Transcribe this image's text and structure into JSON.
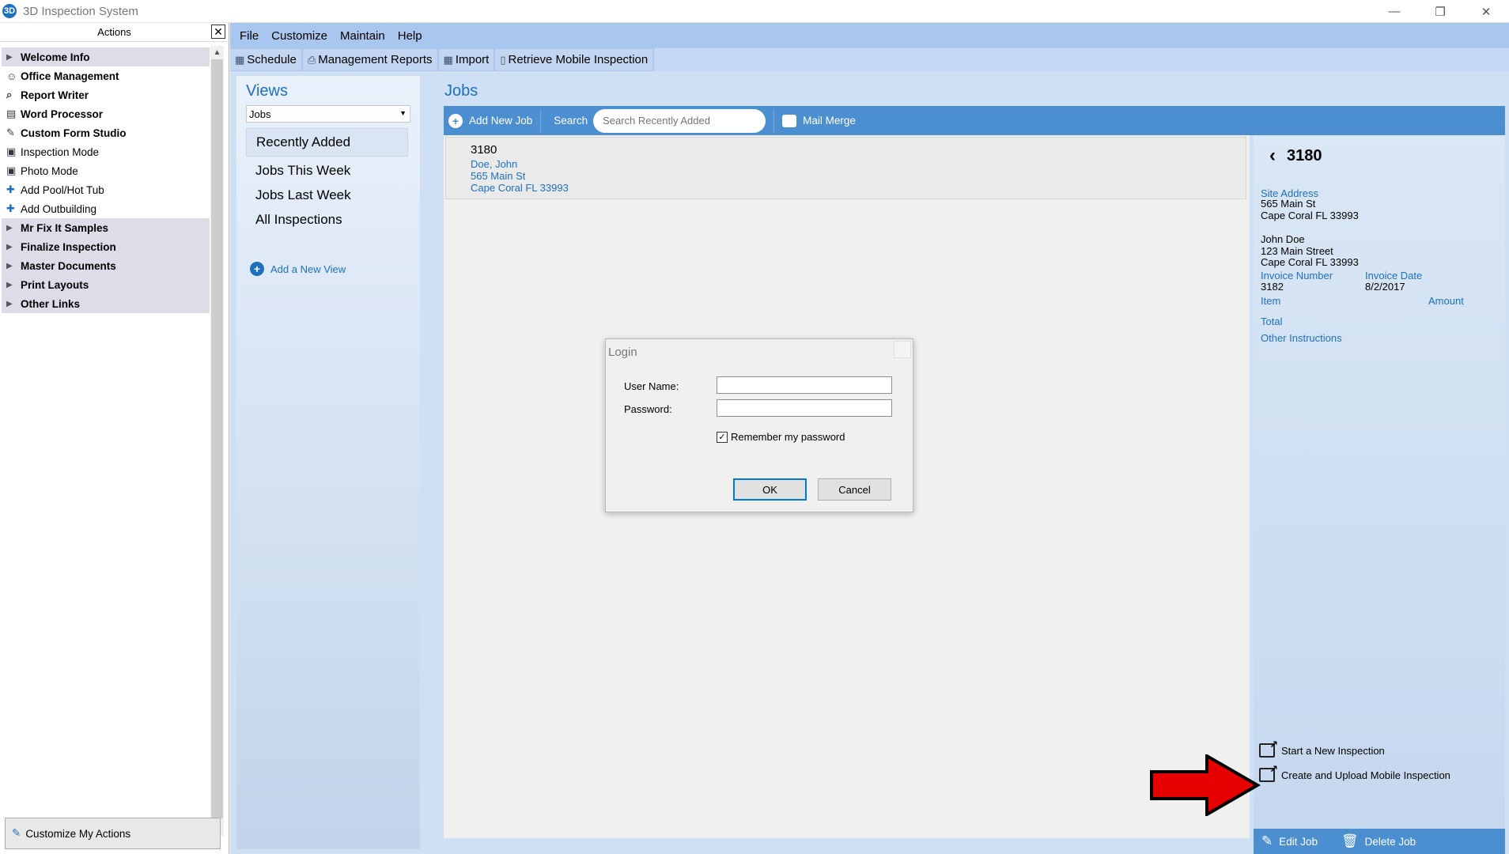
{
  "window": {
    "title": "3D Inspection System",
    "controls": [
      "—",
      "❐",
      "✕"
    ]
  },
  "actions": {
    "header": "Actions",
    "close": "✕",
    "items": [
      {
        "label": "Welcome Info",
        "kind": "group",
        "icon": "expand-arrow"
      },
      {
        "label": "Office Management",
        "kind": "bold",
        "icon": "person-icon"
      },
      {
        "label": "Report Writer",
        "kind": "bold",
        "icon": "magnifier-icon"
      },
      {
        "label": "Word Processor",
        "kind": "bold",
        "icon": "document-icon"
      },
      {
        "label": "Custom Form Studio",
        "kind": "bold",
        "icon": "pencil-icon"
      },
      {
        "label": "Inspection Mode",
        "kind": "plain",
        "icon": "monitor-icon"
      },
      {
        "label": "Photo Mode",
        "kind": "plain",
        "icon": "monitor-icon"
      },
      {
        "label": "Add Pool/Hot Tub",
        "kind": "plain",
        "icon": "plus-icon"
      },
      {
        "label": "Add Outbuilding",
        "kind": "plain",
        "icon": "plus-icon"
      },
      {
        "label": "Mr Fix It Samples",
        "kind": "group",
        "icon": "expand-arrow"
      },
      {
        "label": "Finalize Inspection",
        "kind": "group",
        "icon": "expand-arrow"
      },
      {
        "label": "Master Documents",
        "kind": "group",
        "icon": "expand-arrow"
      },
      {
        "label": "Print Layouts",
        "kind": "group",
        "icon": "expand-arrow"
      },
      {
        "label": "Other Links",
        "kind": "group",
        "icon": "expand-arrow"
      }
    ],
    "customize_label": "Customize My Actions"
  },
  "menubar": [
    "File",
    "Customize",
    "Maintain",
    "Help"
  ],
  "toolbar": [
    "Schedule",
    "Management Reports",
    "Import",
    "Retrieve Mobile Inspection"
  ],
  "views": {
    "title": "Views",
    "selected": "Jobs",
    "items": [
      "Recently Added",
      "Jobs This Week",
      "Jobs Last Week",
      "All Inspections"
    ],
    "active_index": 0,
    "add_label": "Add a New View"
  },
  "jobs": {
    "title": "Jobs",
    "add_label": "Add New Job",
    "search_label": "Search",
    "search_placeholder": "Search Recently Added",
    "mail_merge": "Mail Merge",
    "card": {
      "number": "3180",
      "name": "Doe, John",
      "street": "565 Main St",
      "city": "Cape Coral  FL  33993"
    }
  },
  "detail": {
    "number": "3180",
    "site_address_label": "Site Address",
    "site_line1": "565 Main St",
    "site_line2": "Cape Coral FL 33993",
    "client_name": "John Doe",
    "client_line1": "123 Main Street",
    "client_line2": "Cape Coral FL  33993",
    "invoice_number_label": "Invoice Number",
    "invoice_number": "3182",
    "invoice_date_label": "Invoice Date",
    "invoice_date": "8/2/2017",
    "item_label": "Item",
    "amount_label": "Amount",
    "total_label": "Total",
    "other_label": "Other Instructions",
    "start_new": "Start a New Inspection",
    "create_upload": "Create and Upload Mobile Inspection",
    "edit_job": "Edit Job",
    "delete_job": "Delete Job"
  },
  "login": {
    "title": "Login",
    "username_label": "User Name:",
    "username_value": "",
    "password_label": "Password:",
    "password_value": "",
    "remember_label": "Remember my password",
    "remember_checked": true,
    "ok": "OK",
    "cancel": "Cancel"
  },
  "colors": {
    "accent": "#1f6fbd",
    "bar": "#4c8fd1",
    "annotation_arrow": "#e60000"
  }
}
